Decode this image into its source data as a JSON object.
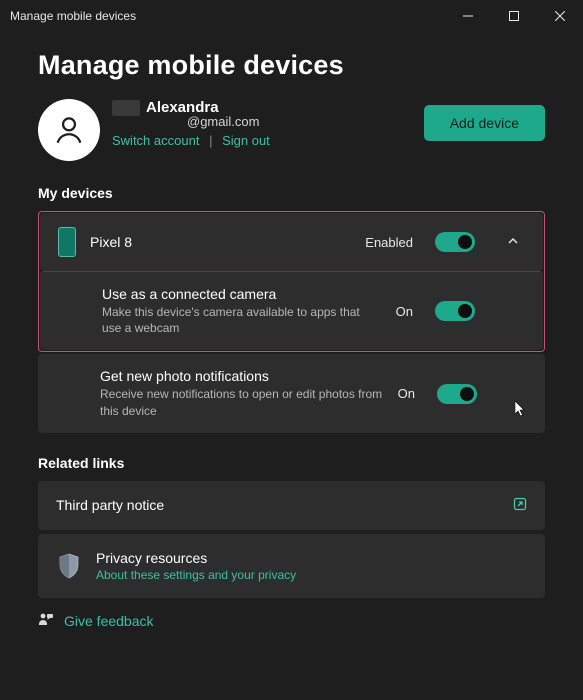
{
  "window": {
    "title": "Manage mobile devices"
  },
  "page": {
    "heading": "Manage mobile devices"
  },
  "account": {
    "name": "Alexandra",
    "email": "@gmail.com",
    "switch_label": "Switch account",
    "signout_label": "Sign out"
  },
  "actions": {
    "add_device": "Add device"
  },
  "devices_section": {
    "label": "My devices",
    "device": {
      "name": "Pixel 8",
      "enabled_label": "Enabled",
      "enabled": true,
      "expanded": true,
      "settings": [
        {
          "title": "Use as a connected camera",
          "description": "Make this device's camera available to apps that use a webcam",
          "state_label": "On",
          "on": true
        },
        {
          "title": "Get new photo notifications",
          "description": "Receive new notifications to open or edit photos from this device",
          "state_label": "On",
          "on": true
        }
      ]
    }
  },
  "related": {
    "label": "Related links",
    "third_party": "Third party notice",
    "privacy_title": "Privacy resources",
    "privacy_sub": "About these settings and your privacy"
  },
  "feedback": {
    "label": "Give feedback"
  }
}
